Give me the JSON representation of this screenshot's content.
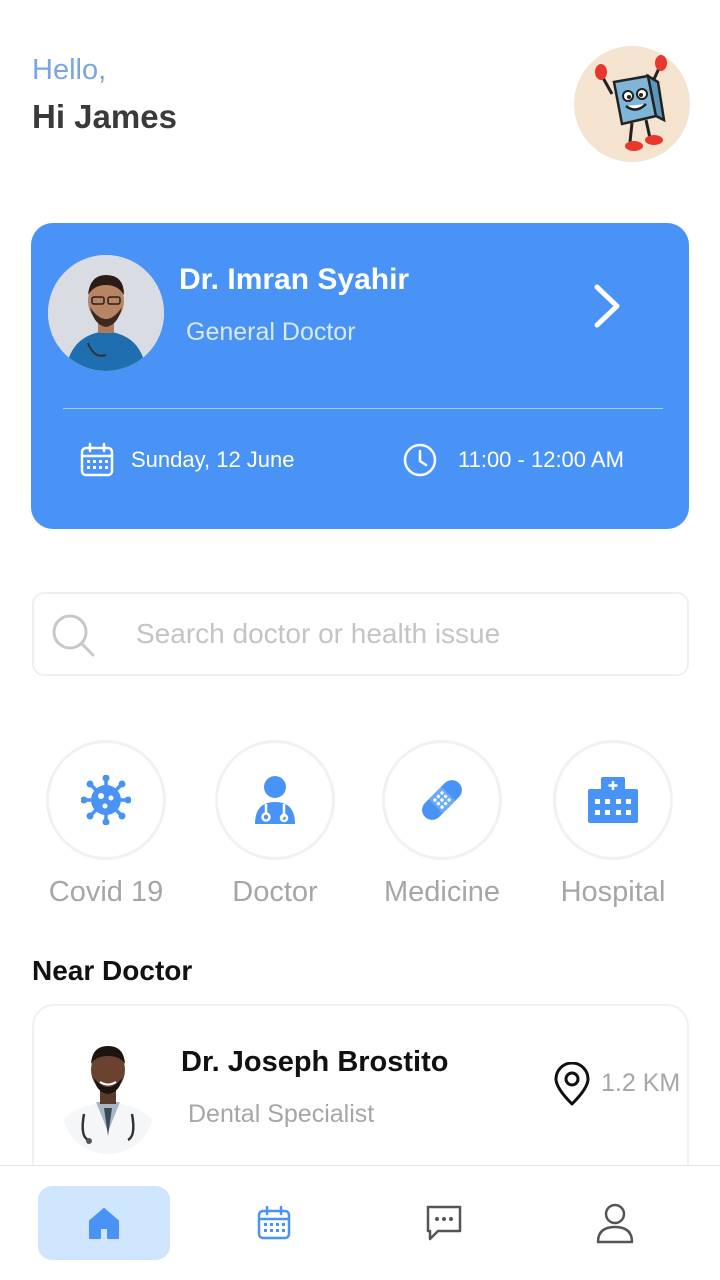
{
  "header": {
    "greeting": "Hello,",
    "user_line": "Hi James",
    "avatar_icon": "cartoon-avatar-icon"
  },
  "appointment": {
    "doctor_name": "Dr. Imran Syahir",
    "specialty": "General Doctor",
    "date": "Sunday, 12 June",
    "time": "11:00 - 12:00 AM",
    "card_color": "#4a93f6"
  },
  "search": {
    "placeholder": "Search doctor or health issue"
  },
  "categories": [
    {
      "label": "Covid 19",
      "icon": "virus-icon"
    },
    {
      "label": "Doctor",
      "icon": "doctor-icon"
    },
    {
      "label": "Medicine",
      "icon": "bandage-icon"
    },
    {
      "label": "Hospital",
      "icon": "hospital-icon"
    }
  ],
  "near": {
    "title": "Near Doctor",
    "doctors": [
      {
        "name": "Dr. Joseph Brostito",
        "specialty": "Dental Specialist",
        "distance": "1.2 KM"
      }
    ]
  },
  "nav": {
    "items": [
      {
        "icon": "home-icon",
        "active": true
      },
      {
        "icon": "calendar-icon",
        "active": false
      },
      {
        "icon": "chat-icon",
        "active": false
      },
      {
        "icon": "profile-icon",
        "active": false
      }
    ],
    "accent": "#4a93f6",
    "active_bg": "#cfe5fd"
  }
}
